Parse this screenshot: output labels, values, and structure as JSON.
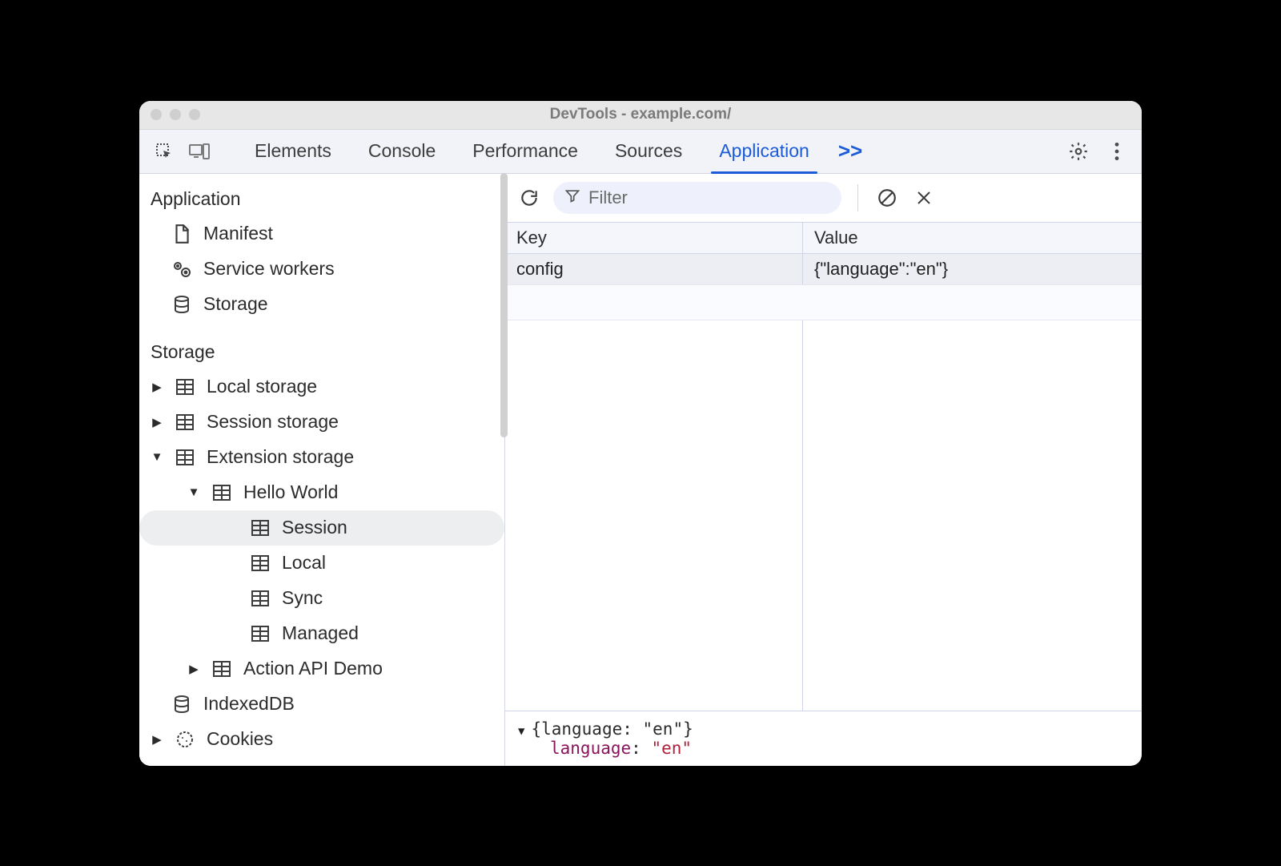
{
  "window": {
    "title": "DevTools - example.com/"
  },
  "tabs": {
    "items": [
      "Elements",
      "Console",
      "Performance",
      "Sources",
      "Application"
    ],
    "active_index": 4,
    "more_glyph": ">>"
  },
  "sidebar": {
    "sections": {
      "application": {
        "heading": "Application",
        "items": [
          {
            "label": "Manifest",
            "icon": "document"
          },
          {
            "label": "Service workers",
            "icon": "gears"
          },
          {
            "label": "Storage",
            "icon": "database"
          }
        ]
      },
      "storage": {
        "heading": "Storage",
        "items": [
          {
            "label": "Local storage",
            "icon": "table",
            "caret": "right"
          },
          {
            "label": "Session storage",
            "icon": "table",
            "caret": "right"
          },
          {
            "label": "Extension storage",
            "icon": "table",
            "caret": "down",
            "children": [
              {
                "label": "Hello World",
                "icon": "table",
                "caret": "down",
                "children": [
                  {
                    "label": "Session",
                    "icon": "table",
                    "selected": true
                  },
                  {
                    "label": "Local",
                    "icon": "table"
                  },
                  {
                    "label": "Sync",
                    "icon": "table"
                  },
                  {
                    "label": "Managed",
                    "icon": "table"
                  }
                ]
              },
              {
                "label": "Action API Demo",
                "icon": "table",
                "caret": "right"
              }
            ]
          },
          {
            "label": "IndexedDB",
            "icon": "database"
          },
          {
            "label": "Cookies",
            "icon": "cookie",
            "caret": "right"
          }
        ]
      }
    }
  },
  "filter": {
    "placeholder": "Filter"
  },
  "table": {
    "columns": [
      "Key",
      "Value"
    ],
    "rows": [
      {
        "key": "config",
        "value": "{\"language\":\"en\"}"
      }
    ]
  },
  "detail": {
    "summary": "{language: \"en\"}",
    "prop_key": "language",
    "prop_val": "\"en\""
  }
}
